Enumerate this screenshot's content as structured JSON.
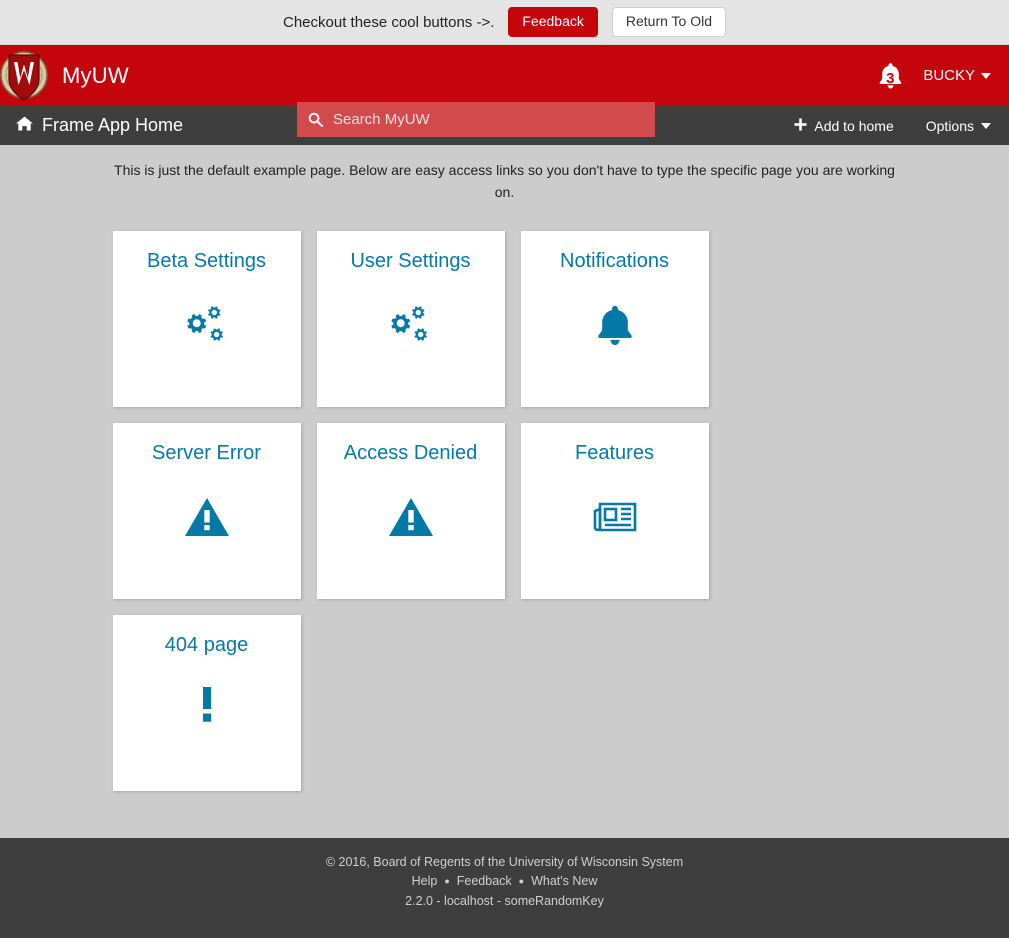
{
  "promo": {
    "text": "Checkout these cool buttons ->.",
    "feedback_label": "Feedback",
    "return_label": "Return To Old"
  },
  "header": {
    "brand": "MyUW",
    "logo_alt": "uw-crest-logo",
    "search_placeholder": "Search MyUW",
    "search_value": "",
    "notification_count": "3",
    "user_name": "BUCKY"
  },
  "subheader": {
    "app_title": "Frame App Home",
    "add_to_home": "Add to home",
    "options": "Options"
  },
  "main": {
    "intro": "This is just the default example page. Below are easy access links so you don't have to type the specific page you are working on.",
    "cards": [
      {
        "title": "Beta Settings",
        "icon": "cogs-icon"
      },
      {
        "title": "User Settings",
        "icon": "cogs-icon"
      },
      {
        "title": "Notifications",
        "icon": "bell-icon"
      },
      {
        "title": "Server Error",
        "icon": "warning-triangle-icon"
      },
      {
        "title": "Access Denied",
        "icon": "warning-triangle-icon"
      },
      {
        "title": "Features",
        "icon": "newspaper-icon"
      },
      {
        "title": "404 page",
        "icon": "exclamation-icon"
      }
    ]
  },
  "footer": {
    "copyright": "© 2016, Board of Regents of the University of Wisconsin System",
    "links": [
      "Help",
      "Feedback",
      "What's New"
    ],
    "version": "2.2.0 - localhost - someRandomKey"
  },
  "colors": {
    "brand_red": "#c5050c",
    "accent_blue": "#0479a8",
    "dark_bar": "#3e3e3e",
    "page_bg": "#cccccc"
  }
}
